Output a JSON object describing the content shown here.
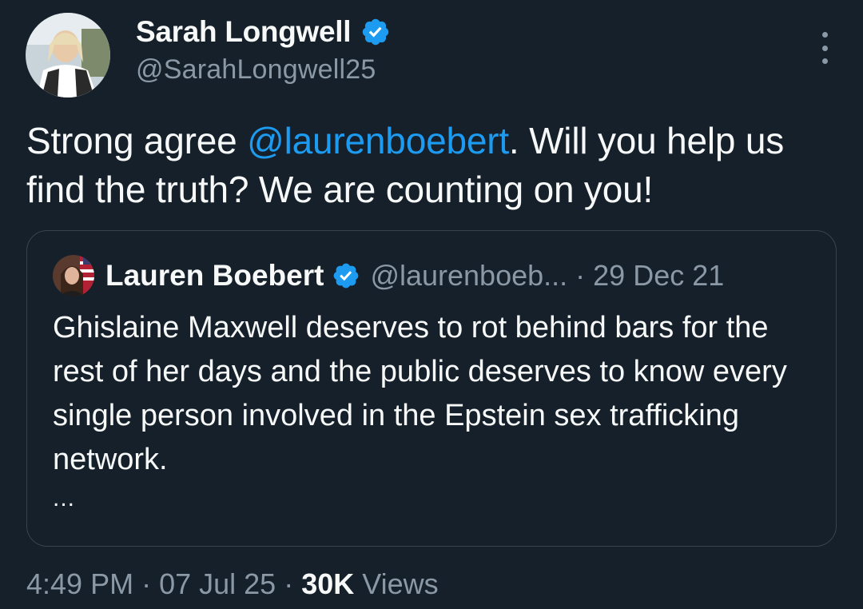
{
  "tweet": {
    "author": {
      "name": "Sarah Longwell",
      "handle": "@SarahLongwell25",
      "verified": true,
      "avatar_icon": "person-photo-avatar"
    },
    "text": {
      "before_mention": "Strong agree ",
      "mention": "@laurenboebert",
      "after_mention": ". Will you help us find the truth? We are counting on you!"
    },
    "quoted": {
      "author_name": "Lauren Boebert",
      "handle": "@laurenboeb...",
      "separator": "·",
      "date": "29 Dec 21",
      "text": "Ghislaine Maxwell deserves to rot behind bars for the rest of her days and the public deserves to know every single person involved in the Epstein sex trafficking network.",
      "more": "..."
    },
    "meta": {
      "time": "4:49 PM",
      "date": "07 Jul 25",
      "views_count": "30K",
      "views_label": "Views"
    }
  },
  "colors": {
    "background": "#15202b",
    "text": "#f7f9f9",
    "secondary_text": "#8b98a5",
    "accent": "#1d9bf0",
    "border": "#38444d"
  }
}
